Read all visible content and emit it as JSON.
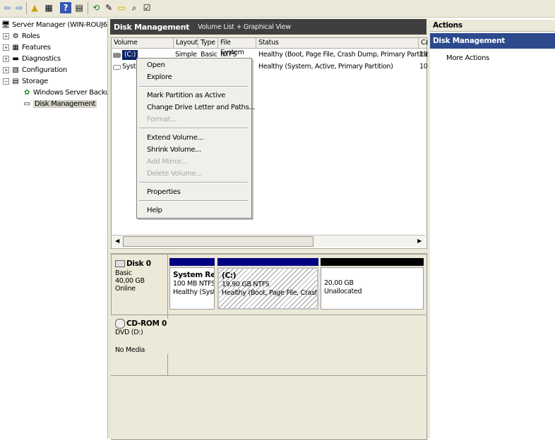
{
  "toolbar": {
    "icons": [
      "back-arrow-icon",
      "forward-arrow-icon",
      "up-folder-icon",
      "show-hide-tree-icon",
      "help-icon",
      "properties-icon",
      "refresh-icon",
      "disk-properties-icon",
      "open-folder-icon",
      "search-icon",
      "checklist-icon"
    ]
  },
  "tree": {
    "items": [
      {
        "label": "Server Manager (WIN-ROUJ60FJEF",
        "level": 0,
        "expander": ""
      },
      {
        "label": "Roles",
        "level": 1,
        "expander": "+"
      },
      {
        "label": "Features",
        "level": 1,
        "expander": "+"
      },
      {
        "label": "Diagnostics",
        "level": 1,
        "expander": "+"
      },
      {
        "label": "Configuration",
        "level": 1,
        "expander": "+"
      },
      {
        "label": "Storage",
        "level": 1,
        "expander": "−"
      },
      {
        "label": "Windows Server Backup",
        "level": 2,
        "expander": ""
      },
      {
        "label": "Disk Management",
        "level": 2,
        "expander": "",
        "selected": true
      }
    ]
  },
  "center": {
    "title": "Disk Management",
    "view": "Volume List + Graphical View",
    "columns": [
      "Volume",
      "Layout",
      "Type",
      "File System",
      "Status",
      "Ca"
    ],
    "rows": [
      {
        "volume": "(C:)",
        "layout": "Simple",
        "type": "Basic",
        "fs": "NTFS",
        "status": "Healthy (Boot, Page File, Crash Dump, Primary Partition)",
        "cap": "19"
      },
      {
        "volume": "Syste",
        "layout": "",
        "type": "",
        "fs": "",
        "status": "Healthy (System, Active, Primary Partition)",
        "cap": "10"
      }
    ]
  },
  "context_menu": {
    "groups": [
      [
        {
          "label": "Open",
          "enabled": true
        },
        {
          "label": "Explore",
          "enabled": true
        }
      ],
      [
        {
          "label": "Mark Partition as Active",
          "enabled": true
        },
        {
          "label": "Change Drive Letter and Paths...",
          "enabled": true
        },
        {
          "label": "Format...",
          "enabled": false
        }
      ],
      [
        {
          "label": "Extend Volume...",
          "enabled": true
        },
        {
          "label": "Shrink Volume...",
          "enabled": true
        },
        {
          "label": "Add Mirror...",
          "enabled": false
        },
        {
          "label": "Delete Volume...",
          "enabled": false
        }
      ],
      [
        {
          "label": "Properties",
          "enabled": true
        }
      ],
      [
        {
          "label": "Help",
          "enabled": true
        }
      ]
    ]
  },
  "disk0": {
    "name": "Disk 0",
    "type": "Basic",
    "size": "40,00 GB",
    "state": "Online",
    "partitions": [
      {
        "name": "System Rese",
        "size": "100 MB NTFS",
        "status": "Healthy (Syste",
        "bar": "#000080"
      },
      {
        "name": "(C:)",
        "size": "19,90 GB NTFS",
        "status": "Healthy (Boot, Page File, Crash Du",
        "bar": "#000080"
      },
      {
        "name": "",
        "size": "20,00 GB",
        "status": "Unallocated",
        "bar": "#000000"
      }
    ]
  },
  "cdrom0": {
    "name": "CD-ROM 0",
    "type": "DVD (D:)",
    "state": "No Media"
  },
  "actions": {
    "title": "Actions",
    "section": "Disk Management",
    "more": "More Actions"
  },
  "colors": {
    "primary_partition": "#000080",
    "unallocated": "#000000",
    "selection": "#0a246a",
    "action_header": "#2c4a8c"
  }
}
